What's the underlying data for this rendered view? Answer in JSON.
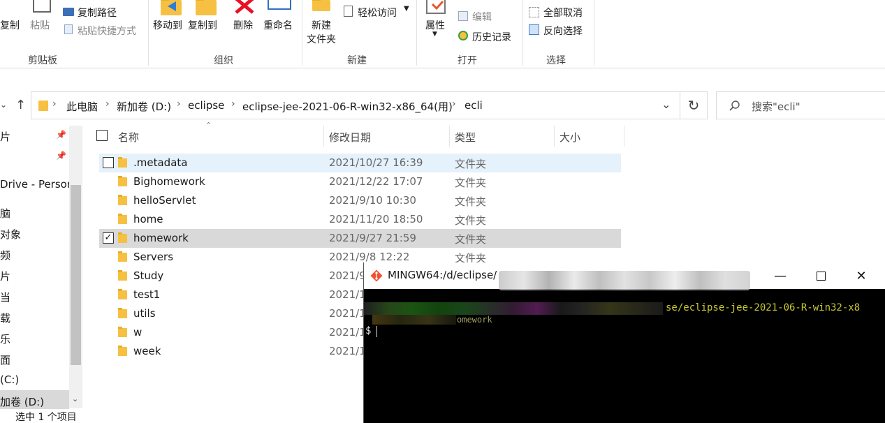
{
  "ribbon": {
    "clipboard": {
      "copy_label": "复制",
      "paste_label": "粘贴",
      "copy_path_label": "复制路径",
      "paste_shortcut_label": "粘贴快捷方式",
      "group_label": "剪贴板"
    },
    "organize": {
      "move_to_label": "移动到",
      "copy_to_label": "复制到",
      "delete_label": "删除",
      "rename_label": "重命名",
      "group_label": "组织"
    },
    "new": {
      "new_folder_label_1": "新建",
      "new_folder_label_2": "文件夹",
      "easy_access_label": "轻松访问",
      "group_label": "新建"
    },
    "open": {
      "properties_label": "属性",
      "edit_label": "编辑",
      "history_label": "历史记录",
      "group_label": "打开"
    },
    "select": {
      "select_none_label": "全部取消",
      "invert_selection_label": "反向选择",
      "group_label": "选择"
    }
  },
  "address": {
    "crumbs": [
      "此电脑",
      "新加卷 (D:)",
      "eclipse",
      "eclipse-jee-2021-06-R-win32-x86_64(用)",
      "ecli"
    ],
    "search_placeholder": "搜索\"ecli\""
  },
  "nav": {
    "items": [
      "片",
      "Drive - Person",
      "脑",
      "对象",
      "频",
      "片",
      "当",
      "载",
      "乐",
      "面",
      "(C:)",
      "加卷 (D:)"
    ]
  },
  "columns": {
    "name": "名称",
    "date": "修改日期",
    "type": "类型",
    "size": "大小"
  },
  "files": [
    {
      "name": ".metadata",
      "date": "2021/10/27 16:39",
      "type": "文件夹",
      "state": "hover"
    },
    {
      "name": "Bighomework",
      "date": "2021/12/22 17:07",
      "type": "文件夹",
      "state": ""
    },
    {
      "name": "helloServlet",
      "date": "2021/9/10 10:30",
      "type": "文件夹",
      "state": ""
    },
    {
      "name": "home",
      "date": "2021/11/20 18:50",
      "type": "文件夹",
      "state": ""
    },
    {
      "name": "homework",
      "date": "2021/9/27 21:59",
      "type": "文件夹",
      "state": "selected"
    },
    {
      "name": "Servers",
      "date": "2021/9/8 12:22",
      "type": "文件夹",
      "state": ""
    },
    {
      "name": "Study",
      "date": "2021/9",
      "type": "",
      "state": ""
    },
    {
      "name": "test1",
      "date": "2021/1",
      "type": "",
      "state": ""
    },
    {
      "name": "utils",
      "date": "2021/1",
      "type": "",
      "state": ""
    },
    {
      "name": "w",
      "date": "2021/1",
      "type": "",
      "state": ""
    },
    {
      "name": "week",
      "date": "2021/1",
      "type": "",
      "state": ""
    }
  ],
  "status": {
    "text": "选中 1 个项目"
  },
  "terminal": {
    "title": "MINGW64:/d/eclipse/",
    "line1_visible": "se/eclipse-jee-2021-06-R-win32-x8",
    "line2_visible": "omework",
    "prompt": "$",
    "path_color": "#c9c930",
    "line2_color": "#a0a060"
  },
  "colors": {
    "folder": "#f6c143",
    "hover_row": "#e5f1fb",
    "selected_row": "#d9d9d9",
    "delete_red": "#e81123"
  }
}
